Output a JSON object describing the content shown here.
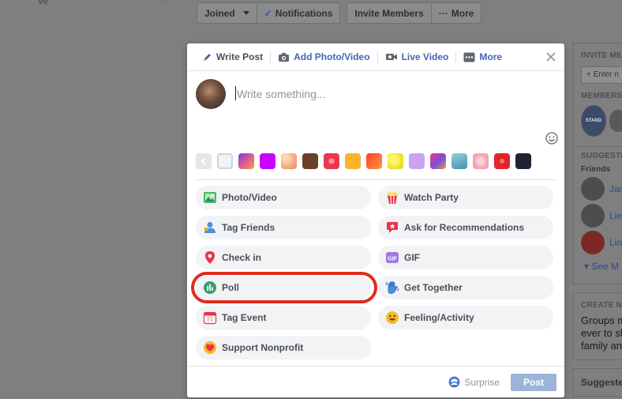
{
  "background": {
    "fragment_left": "ve",
    "fragment_right": "..."
  },
  "topbar": {
    "joined_label": "Joined",
    "notifications_label": "Notifications",
    "invite_label": "Invite Members",
    "more_label": "More"
  },
  "right_sidebar": {
    "invite_heading": "INVITE ME",
    "invite_placeholder": "+ Enter n",
    "members_heading": "MEMBERS",
    "member_badge": "STAND",
    "suggested_heading": "SUGGESTE",
    "friends_label": "Friends",
    "friends": [
      "Jan",
      "Lie",
      "Lin"
    ],
    "see_more": "See M",
    "create_heading": "CREATE N",
    "create_text": [
      "Groups m",
      "ever to sh",
      "family an"
    ],
    "suggested_footer": "Suggeste"
  },
  "composer": {
    "tabs": [
      {
        "label": "Write Post",
        "icon": "pencil-icon",
        "active": true
      },
      {
        "label": "Add Photo/Video",
        "icon": "camera-icon",
        "active": false
      },
      {
        "label": "Live Video",
        "icon": "video-camera-icon",
        "active": false
      },
      {
        "label": "More",
        "icon": "more-icon",
        "active": false
      }
    ],
    "placeholder": "Write something...",
    "background_swatches": [
      "#f2f3f5",
      "gradient-purple-orange",
      "#c800ff",
      "peach-pattern",
      "#6b3f2a",
      "red-pattern",
      "#f7b42c",
      "#ff5f2e",
      "#e9e52b",
      "#c9a3f0",
      "gradient-blue-pink",
      "#6ab4c8",
      "pink-pattern",
      "#e0262b",
      "#1f2335"
    ],
    "actions": [
      {
        "label": "Photo/Video",
        "icon": "photo-icon",
        "name": "action-photo-video"
      },
      {
        "label": "Watch Party",
        "icon": "popcorn-icon",
        "name": "action-watch-party"
      },
      {
        "label": "Tag Friends",
        "icon": "tag-friends-icon",
        "name": "action-tag-friends"
      },
      {
        "label": "Ask for Recommendations",
        "icon": "recommendation-icon",
        "name": "action-ask-recommendations"
      },
      {
        "label": "Check in",
        "icon": "location-pin-icon",
        "name": "action-check-in"
      },
      {
        "label": "GIF",
        "icon": "gif-icon",
        "name": "action-gif"
      },
      {
        "label": "Poll",
        "icon": "poll-icon",
        "name": "action-poll"
      },
      {
        "label": "Get Together",
        "icon": "wave-hand-icon",
        "name": "action-get-together"
      },
      {
        "label": "Tag Event",
        "icon": "calendar-icon",
        "name": "action-tag-event"
      },
      {
        "label": "Feeling/Activity",
        "icon": "smiley-icon",
        "name": "action-feeling-activity"
      },
      {
        "label": "Support Nonprofit",
        "icon": "heart-icon",
        "name": "action-support-nonprofit"
      }
    ],
    "surprise_label": "Surprise",
    "post_label": "Post"
  },
  "colors": {
    "brand": "#4267b2",
    "highlight_ring": "#e02b1b",
    "post_disabled": "#9cb4d8"
  }
}
